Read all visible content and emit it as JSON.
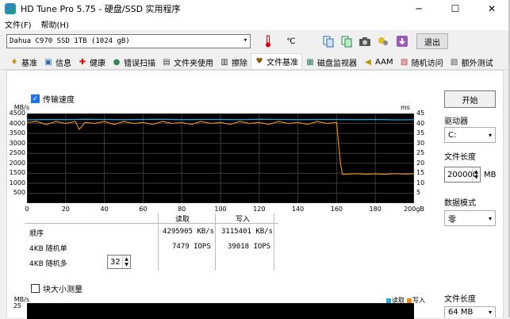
{
  "window": {
    "title": "HD Tune Pro 5.75 - 硬盘/SSD 实用程序",
    "min": "─",
    "max": "☐",
    "close": "✕"
  },
  "menu": [
    "文件(F)",
    "帮助(H)"
  ],
  "toolbar": {
    "drive": "Dahua C970 SSD 1TB (1024 gB)",
    "exit_label": "退出",
    "icons": [
      "thermometer-icon",
      "temperature-value-icon",
      "copy-icon",
      "copy-all-icon",
      "camera-icon",
      "options-icon",
      "save-icon"
    ],
    "temp_glyph": "℃"
  },
  "tabs": [
    {
      "label": "基准",
      "icon": "benchmark-icon"
    },
    {
      "label": "信息",
      "icon": "info-icon"
    },
    {
      "label": "健康",
      "icon": "health-icon"
    },
    {
      "label": "错误扫描",
      "icon": "error-scan-icon"
    },
    {
      "label": "文件夹使用",
      "icon": "folder-usage-icon"
    },
    {
      "label": "擦除",
      "icon": "erase-icon"
    },
    {
      "label": "文件基准",
      "icon": "file-benchmark-icon",
      "active": true
    },
    {
      "label": "磁盘监视器",
      "icon": "disk-monitor-icon"
    },
    {
      "label": "AAM",
      "icon": "aam-icon"
    },
    {
      "label": "随机访问",
      "icon": "random-access-icon"
    },
    {
      "label": "额外测试",
      "icon": "extra-tests-icon"
    }
  ],
  "transfer": {
    "checkbox_label": "传输速度",
    "checked": true
  },
  "chart_data": {
    "type": "line",
    "y_unit_left": "MB/s",
    "y_unit_right": "ms",
    "y_ticks_left": [
      "4500",
      "4000",
      "3500",
      "3000",
      "2500",
      "2000",
      "1500",
      "1000",
      "500"
    ],
    "y_ticks_right": [
      "45",
      "40",
      "35",
      "30",
      "25",
      "20",
      "15",
      "10",
      "5"
    ],
    "x_ticks": [
      "0",
      "20",
      "40",
      "60",
      "80",
      "100",
      "120",
      "140",
      "160",
      "180",
      "200gB"
    ],
    "xlim": [
      0,
      200
    ],
    "ylim": [
      0,
      4500
    ],
    "grid": true,
    "series": [
      {
        "color": "#2aa7e0",
        "x": [
          0,
          10,
          20,
          30,
          40,
          50,
          60,
          70,
          80,
          90,
          100,
          110,
          120,
          130,
          140,
          150,
          160,
          170,
          180,
          190,
          200
        ],
        "values": [
          4180,
          4200,
          4190,
          4210,
          4200,
          4190,
          4200,
          4210,
          4190,
          4200,
          4200,
          4190,
          4210,
          4200,
          4190,
          4200,
          4200,
          4190,
          4200,
          4180,
          4190
        ]
      },
      {
        "color": "#e8871e",
        "x": [
          0,
          5,
          10,
          15,
          20,
          25,
          27,
          30,
          35,
          40,
          45,
          50,
          55,
          60,
          65,
          70,
          75,
          80,
          85,
          90,
          95,
          100,
          105,
          110,
          115,
          120,
          125,
          130,
          135,
          140,
          145,
          150,
          155,
          160,
          161,
          162,
          163,
          165,
          170,
          175,
          180,
          185,
          190,
          195,
          200
        ],
        "values": [
          4050,
          4100,
          3950,
          4100,
          4000,
          4100,
          3700,
          4050,
          4000,
          4100,
          3950,
          4100,
          4000,
          4050,
          3950,
          4100,
          4000,
          4050,
          3950,
          4100,
          4000,
          4050,
          3950,
          4100,
          4000,
          4050,
          3950,
          4100,
          4000,
          4050,
          3950,
          4100,
          4000,
          4050,
          3000,
          2000,
          1450,
          1450,
          1480,
          1450,
          1470,
          1450,
          1480,
          1460,
          1470
        ]
      }
    ]
  },
  "results": {
    "read_header": "读取",
    "write_header": "写入",
    "rows": [
      {
        "label": "顺序",
        "read": "4295905 KB/s",
        "write": "3115401 KB/s"
      },
      {
        "label": "4KB 随机单",
        "read": "7479 IOPS",
        "write": "39018 IOPS"
      },
      {
        "label": "4KB 随机多",
        "read": "",
        "write": ""
      }
    ],
    "queue_depth": "32"
  },
  "side": {
    "start_label": "开始",
    "drive_label": "驱动器",
    "drive_value": "C:",
    "file_len_label": "文件长度",
    "file_len_value": "200000",
    "file_len_unit": "MB",
    "data_mode_label": "数据模式",
    "data_mode_value": "零"
  },
  "lower": {
    "checkbox_label": "块大小测量",
    "checked": false,
    "y_unit": "MB/s",
    "y_tick": "25",
    "legend_read": "读取",
    "legend_write": "写入",
    "file_len_label": "文件长度",
    "file_len_value": "64 MB"
  }
}
